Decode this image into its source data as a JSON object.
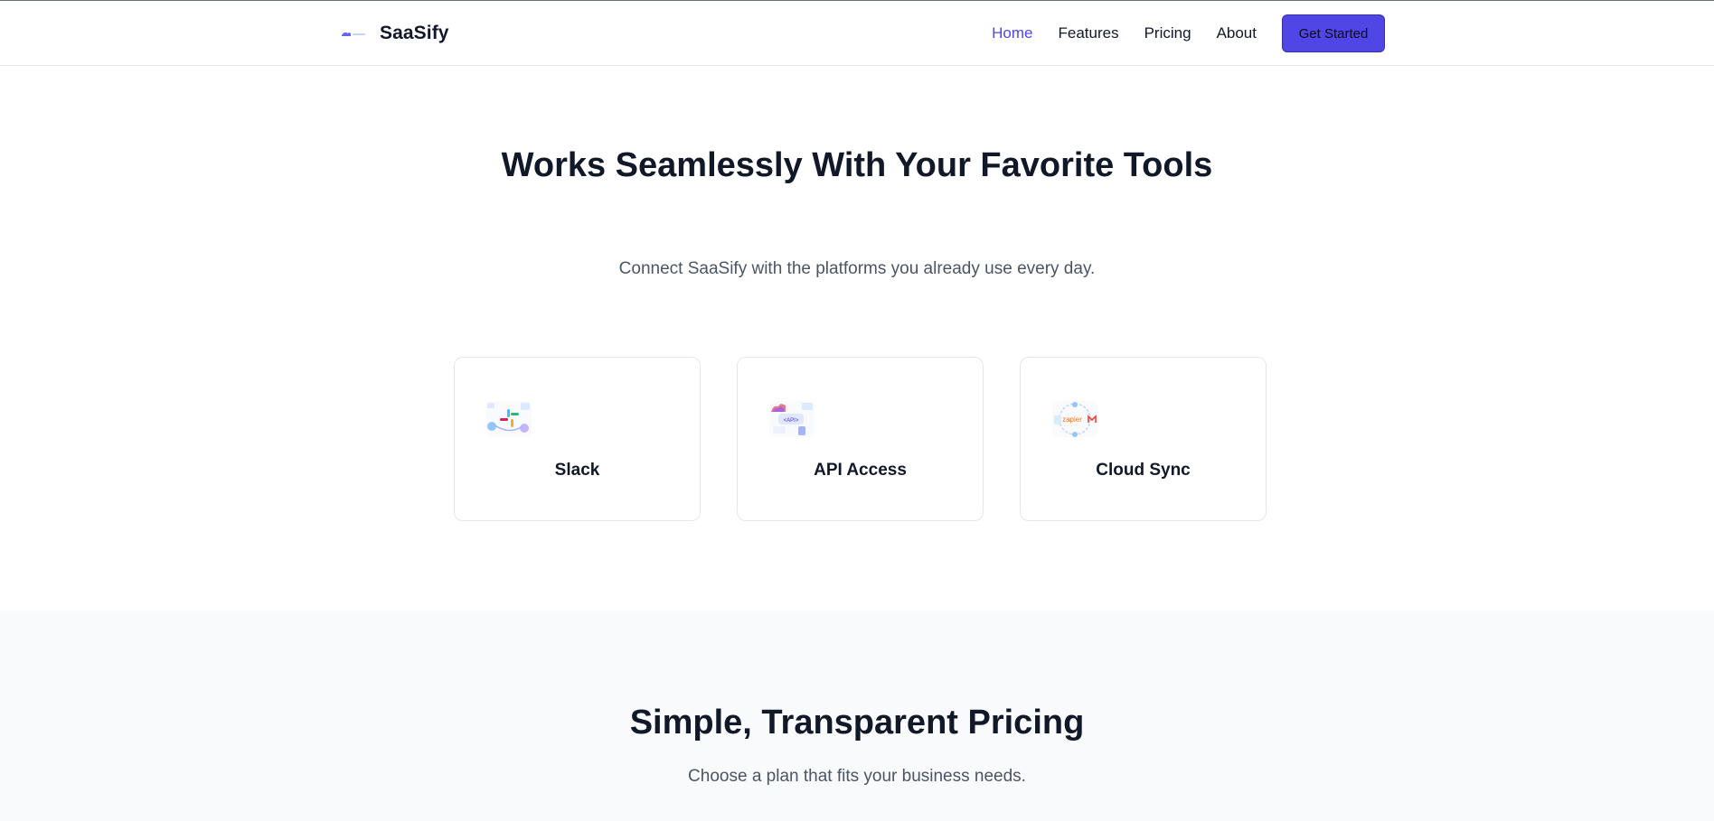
{
  "header": {
    "brand": "SaaSify",
    "nav": {
      "home": "Home",
      "features": "Features",
      "pricing": "Pricing",
      "about": "About"
    },
    "cta": "Get Started"
  },
  "integrations": {
    "title": "Works Seamlessly With Your Favorite Tools",
    "subtitle": "Connect SaaSify with the platforms you already use every day.",
    "cards": [
      {
        "label": "Slack",
        "icon": "slack-integration-illustration"
      },
      {
        "label": "API Access",
        "icon": "api-integration-illustration",
        "image_text": "<API>"
      },
      {
        "label": "Cloud Sync",
        "icon": "cloud-sync-illustration",
        "image_text": "zapier"
      }
    ]
  },
  "pricing": {
    "title": "Simple, Transparent Pricing",
    "subtitle": "Choose a plan that fits your business needs."
  },
  "colors": {
    "accent": "#4f46e5",
    "text": "#111827",
    "muted": "#4b5563",
    "section_bg": "#f9fafb",
    "border": "#e5e7eb"
  }
}
